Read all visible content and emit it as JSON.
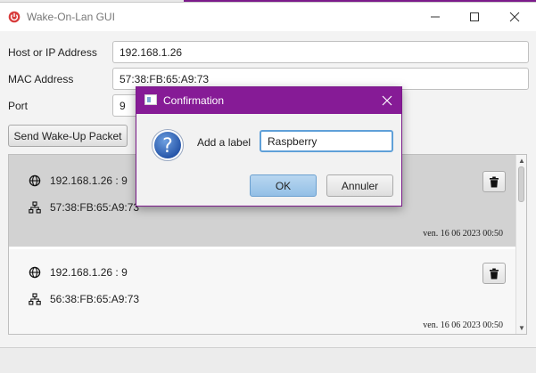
{
  "taskbar_bg": {
    "accent": "#7b1a8a"
  },
  "window": {
    "title": "Wake-On-Lan GUI",
    "icon": "power-icon",
    "controls": [
      "minimize-icon",
      "maximize-icon",
      "close-icon"
    ]
  },
  "form": {
    "host_label": "Host or IP Address",
    "host_value": "192.168.1.26",
    "mac_label": "MAC Address",
    "mac_value": "57:38:FB:65:A9:73",
    "port_label": "Port",
    "port_value": "9",
    "send_button": "Send Wake-Up Packet"
  },
  "entries": [
    {
      "host": "192.168.1.26 : 9",
      "mac": "57:38:FB:65:A9:73",
      "date": "ven. 16 06 2023 00:50",
      "selected": true
    },
    {
      "host": "192.168.1.26 : 9",
      "mac": "56:38:FB:65:A9:73",
      "date": "ven. 16 06 2023 00:50",
      "selected": false
    }
  ],
  "dialog": {
    "title": "Confirmation",
    "label": "Add a label",
    "input_value": "Raspberry",
    "ok": "OK",
    "cancel": "Annuler",
    "accent": "#861b96",
    "icon": "help-icon"
  }
}
